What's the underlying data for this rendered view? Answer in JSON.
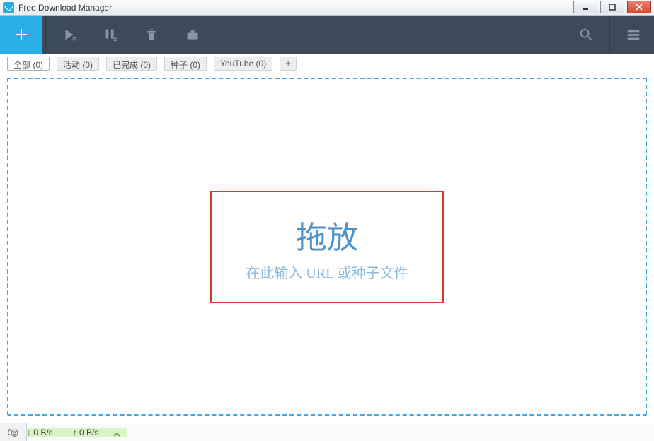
{
  "window": {
    "title": "Free Download Manager"
  },
  "tabs": [
    {
      "label": "全部 (0)",
      "active": true
    },
    {
      "label": "活动 (0)",
      "active": false
    },
    {
      "label": "已完成 (0)",
      "active": false
    },
    {
      "label": "种子 (0)",
      "active": false
    },
    {
      "label": "YouTube (0)",
      "active": false
    }
  ],
  "tab_add": "+",
  "drop": {
    "title": "拖放",
    "subtitle": "在此输入 URL 或种子文件"
  },
  "status": {
    "down_label": "↓ 0 B/s",
    "up_label": "↑ 0 B/s"
  }
}
